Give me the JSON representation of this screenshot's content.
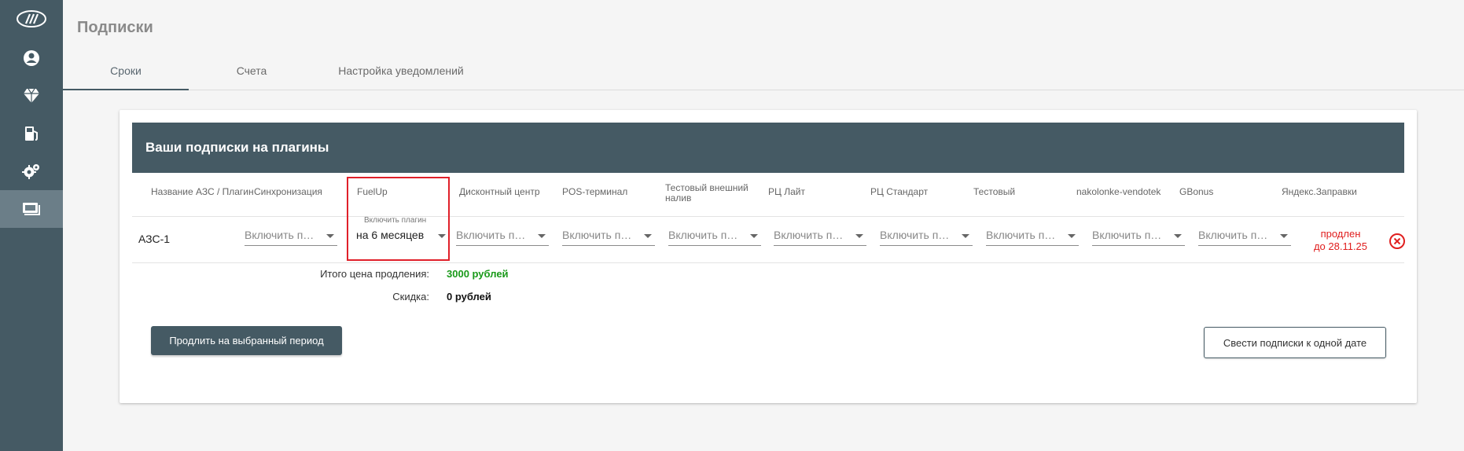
{
  "page": {
    "title": "Подписки"
  },
  "tabs": [
    {
      "label": "Сроки",
      "active": true
    },
    {
      "label": "Счета",
      "active": false
    },
    {
      "label": "Настройка уведомлений",
      "active": false
    }
  ],
  "card": {
    "title": "Ваши подписки на плагины"
  },
  "table": {
    "station_header": "Название АЗС / Плагин",
    "plugins": [
      "Синхронизация",
      "FuelUp",
      "Дисконтный центр",
      "POS-терминал",
      "Тестовый внешний налив",
      "РЦ Лайт",
      "РЦ Стандарт",
      "Тестовый",
      "nakolonke-vendotek",
      "GBonus",
      "Яндекс.Заправки"
    ],
    "rows": [
      {
        "station": "АЗС-1",
        "selects": [
          {
            "value": "Включить плагин",
            "label": ""
          },
          {
            "value": "на 6 месяцев",
            "label": "Включить плагин"
          },
          {
            "value": "Включить плагин",
            "label": ""
          },
          {
            "value": "Включить плагин",
            "label": ""
          },
          {
            "value": "Включить плагин",
            "label": ""
          },
          {
            "value": "Включить плагин",
            "label": ""
          },
          {
            "value": "Включить плагин",
            "label": ""
          },
          {
            "value": "Включить плагин",
            "label": ""
          },
          {
            "value": "Включить плагин",
            "label": ""
          },
          {
            "value": "Включить плагин",
            "label": ""
          }
        ],
        "status_line1": "продлен",
        "status_line2": "до 28.11.25"
      }
    ]
  },
  "summary": {
    "total_label": "Итого цена продления:",
    "total_value": "3000 рублей",
    "discount_label": "Скидка:",
    "discount_value": "0 рублей"
  },
  "buttons": {
    "extend": "Продлить на выбранный период",
    "align": "Свести подписки к одной дате"
  },
  "colors": {
    "sidebar": "#455a64",
    "accent_green": "#1a9a1a",
    "status_red": "#e01e1e",
    "highlight": "#e0202a"
  },
  "icons": [
    "logo-icon",
    "user-icon",
    "diamond-icon",
    "fuel-station-icon",
    "settings-icon",
    "subscriptions-icon"
  ]
}
